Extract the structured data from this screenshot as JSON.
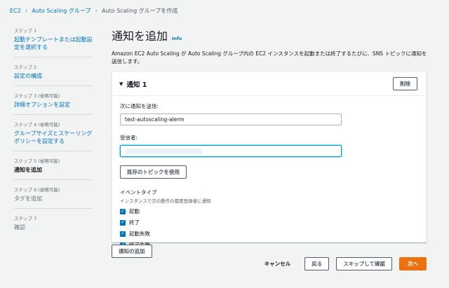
{
  "breadcrumb": {
    "items": [
      "EC2",
      "Auto Scaling グループ"
    ],
    "current": "Auto Scaling グループを作成"
  },
  "steps": [
    {
      "label": "ステップ 1",
      "title": "起動テンプレートまたは起動設定を選択する",
      "state": "link"
    },
    {
      "label": "ステップ 2",
      "title": "設定の構成",
      "state": "link"
    },
    {
      "label": "ステップ 3 (省略可能)",
      "title": "詳細オプションを設定",
      "state": "link"
    },
    {
      "label": "ステップ 4 (省略可能)",
      "title": "グループサイズとスケーリングポリシーを設定する",
      "state": "link"
    },
    {
      "label": "ステップ 5 (省略可能)",
      "title": "通知を追加",
      "state": "active"
    },
    {
      "label": "ステップ 6 (省略可能)",
      "title": "タグを追加",
      "state": "disabled"
    },
    {
      "label": "ステップ 7",
      "title": "確認",
      "state": "disabled"
    }
  ],
  "main": {
    "title": "通知を追加",
    "info": "Info",
    "description": "Amazon EC2 Auto Scaling が Auto Scaling グループ内の EC2 インスタンスを起動または終了するたびに、SNS トピックに通知を送信します。"
  },
  "notification": {
    "title": "通知 1",
    "delete_label": "削除",
    "send_to_label": "次に通知を送信:",
    "send_to_value": "test-autoscaling-alerm",
    "recipients_label": "受信者:",
    "use_existing_topic_label": "既存のトピックを使用",
    "event_type_title": "イベントタイプ",
    "event_type_desc": "インスタンスで次の動作の都度登録者に通知",
    "events": [
      {
        "label": "起動",
        "checked": true
      },
      {
        "label": "終了",
        "checked": true
      },
      {
        "label": "起動失敗",
        "checked": true
      },
      {
        "label": "終了失敗",
        "checked": true
      }
    ]
  },
  "add_notification_label": "通知の追加",
  "footer": {
    "cancel": "キャンセル",
    "back": "戻る",
    "skip": "スキップして確認",
    "next": "次へ"
  },
  "colors": {
    "link": "#0073bb",
    "primary": "#ec7211",
    "background": "#f2f3f3"
  }
}
